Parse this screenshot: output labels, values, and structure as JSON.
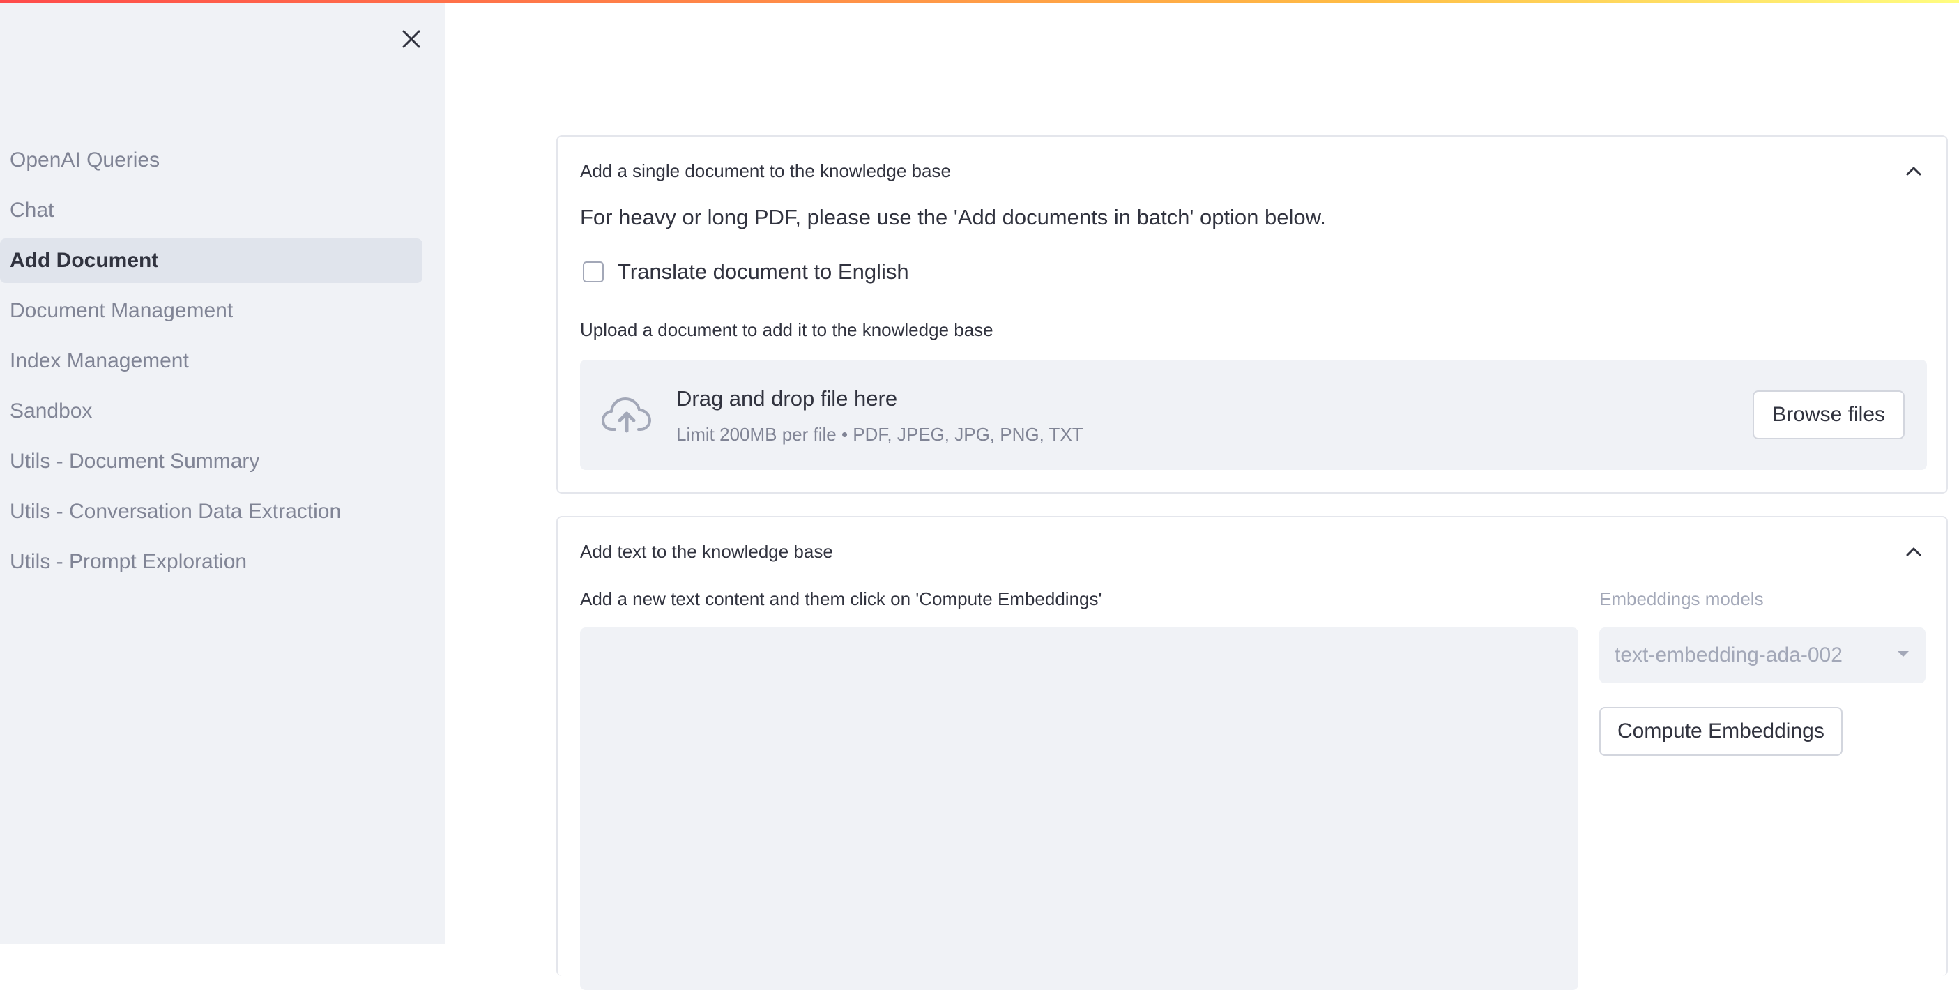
{
  "sidebar": {
    "close_icon": "close-icon",
    "items": [
      {
        "label": "OpenAI Queries"
      },
      {
        "label": "Chat"
      },
      {
        "label": "Add Document",
        "active": true
      },
      {
        "label": "Document Management"
      },
      {
        "label": "Index Management"
      },
      {
        "label": "Sandbox"
      },
      {
        "label": "Utils - Document Summary"
      },
      {
        "label": "Utils - Conversation Data Extraction"
      },
      {
        "label": "Utils - Prompt Exploration"
      }
    ]
  },
  "single_doc": {
    "title": "Add a single document to the knowledge base",
    "note": "For heavy or long PDF, please use the 'Add documents in batch' option below.",
    "translate_label": "Translate document to English",
    "translate_checked": false,
    "upload_label": "Upload a document to add it to the knowledge base",
    "dropzone_title": "Drag and drop file here",
    "dropzone_limit": "Limit 200MB per file • PDF, JPEG, JPG, PNG, TXT",
    "browse_label": "Browse files"
  },
  "add_text": {
    "title": "Add text to the knowledge base",
    "text_label": "Add a new text content and them click on 'Compute Embeddings'",
    "text_value": "",
    "model_label": "Embeddings models",
    "model_value": "text-embedding-ada-002",
    "compute_label": "Compute Embeddings"
  },
  "colors": {
    "sidebar_bg": "#f0f2f6",
    "active_item_bg": "#e0e4ec",
    "text": "#31333f",
    "muted_text": "#808495",
    "accent_gradient_start": "#ff4b4b",
    "accent_gradient_end": "#fffd80"
  }
}
